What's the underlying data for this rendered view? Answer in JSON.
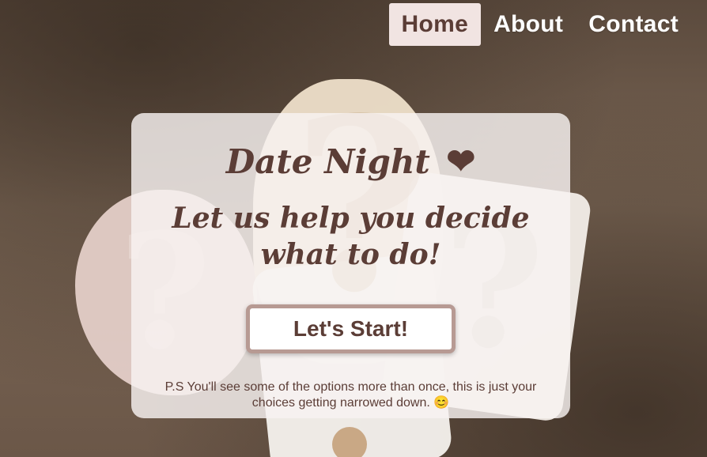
{
  "nav": {
    "items": [
      {
        "label": "Home",
        "active": true
      },
      {
        "label": "About",
        "active": false
      },
      {
        "label": "Contact",
        "active": false
      }
    ]
  },
  "hero": {
    "title": "Date Night",
    "title_icon": "heart-icon",
    "subtitle": "Let us help you decide what to do!",
    "start_button": "Let's Start!",
    "note": "P.S You'll see some of the options more than once, this is just your choices getting narrowed down. 😊"
  },
  "colors": {
    "accent": "#5b3d36",
    "nav_active_bg": "#f1e4e2",
    "card_bg": "#f8f3f1",
    "button_border": "#b79a93"
  }
}
